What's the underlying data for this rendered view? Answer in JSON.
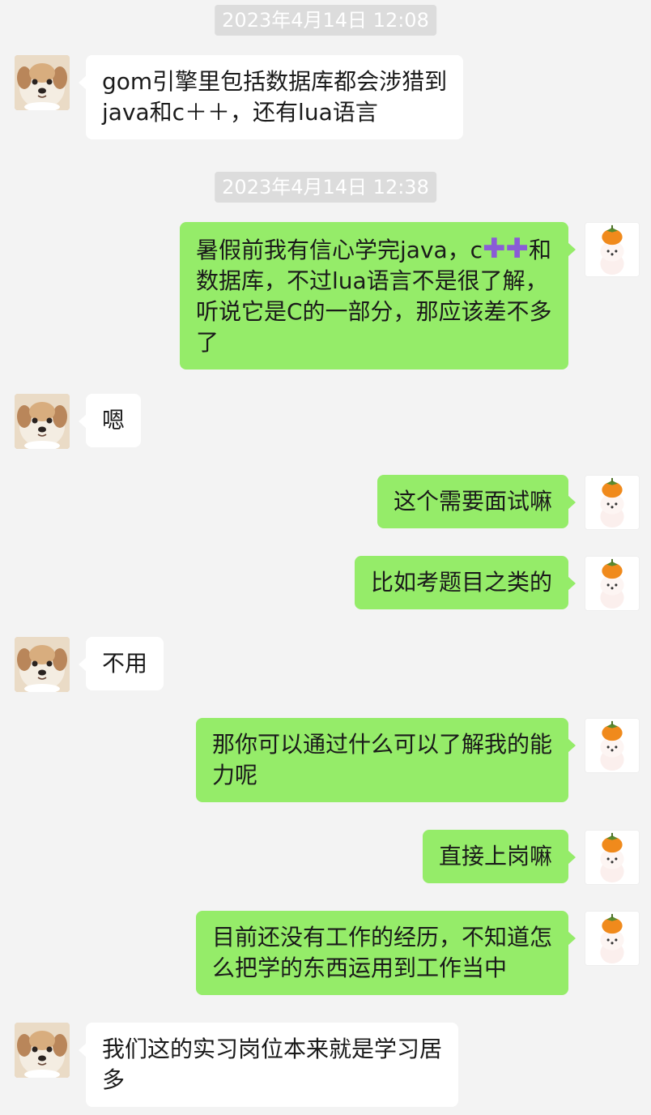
{
  "timestamps": [
    "2023年4月14日 12:08",
    "2023年4月14日 12:38"
  ],
  "avatars": {
    "contact": "puppy-avatar",
    "me": "persimmon-dog-avatar"
  },
  "messages": [
    {
      "side": "in",
      "text": "gom引擎里包括数据库都会涉猎到java和c＋＋，还有lua语言"
    },
    {
      "side": "out",
      "text_before": "暑假前我有信心学完java，c",
      "emoji": "✚✚",
      "text_after": "和数据库，不过lua语言不是很了解，听说它是C的一部分，那应该差不多了"
    },
    {
      "side": "in",
      "text": "嗯"
    },
    {
      "side": "out",
      "text": "这个需要面试嘛"
    },
    {
      "side": "out",
      "text": "比如考题目之类的"
    },
    {
      "side": "in",
      "text": "不用"
    },
    {
      "side": "out",
      "text": "那你可以通过什么可以了解我的能力呢"
    },
    {
      "side": "out",
      "text": "直接上岗嘛"
    },
    {
      "side": "out",
      "text": "目前还没有工作的经历，不知道怎么把学的东西运用到工作当中"
    },
    {
      "side": "in",
      "text": "我们这的实习岗位本来就是学习居多"
    }
  ]
}
